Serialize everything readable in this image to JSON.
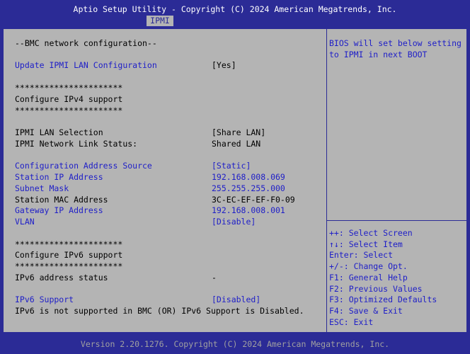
{
  "header": {
    "title": "Aptio Setup Utility - Copyright (C) 2024 American Megatrends, Inc.",
    "active_tab": "IPMI"
  },
  "main": {
    "section_title": "--BMC network configuration--",
    "update_lan": {
      "label": "Update IPMI LAN Configuration",
      "value": "[Yes]"
    },
    "ipv4": {
      "stars_top": "**********************",
      "heading": "Configure IPv4 support",
      "stars_bottom": "**********************"
    },
    "lan_selection": {
      "label": "IPMI LAN Selection",
      "value": "[Share LAN]"
    },
    "link_status": {
      "label": "IPMI Network Link Status:",
      "value": "Shared LAN"
    },
    "config_source": {
      "label": "Configuration Address Source",
      "value": "[Static]"
    },
    "station_ip": {
      "label": "Station IP Address",
      "value": "192.168.008.069"
    },
    "subnet": {
      "label": "Subnet Mask",
      "value": "255.255.255.000"
    },
    "mac": {
      "label": "Station MAC Address",
      "value": "3C-EC-EF-EF-F0-09"
    },
    "gateway": {
      "label": "Gateway IP Address",
      "value": "192.168.008.001"
    },
    "vlan": {
      "label": "VLAN",
      "value": "[Disable]"
    },
    "ipv6": {
      "stars_top": "**********************",
      "heading": "Configure IPv6 support",
      "stars_bottom": "**********************"
    },
    "ipv6_status": {
      "label": "IPv6 address status",
      "value": "-"
    },
    "ipv6_support": {
      "label": "IPv6 Support",
      "value": "[Disabled]"
    },
    "ipv6_note": "IPv6 is not supported in BMC (OR) IPv6 Support is Disabled."
  },
  "help": {
    "description_line1": "BIOS will set below setting",
    "description_line2": "to IPMI in next BOOT",
    "keys": [
      "++: Select Screen",
      "↑↓: Select Item",
      "Enter: Select",
      "+/-: Change Opt.",
      "F1: General Help",
      "F2: Previous Values",
      "F3: Optimized Defaults",
      "F4: Save & Exit",
      "ESC: Exit"
    ]
  },
  "footer": {
    "version": "Version 2.20.1276. Copyright (C) 2024 American Megatrends, Inc."
  },
  "colors": {
    "background": "#2b2b96",
    "panel": "#b4b4b4",
    "selectable_text": "#1e1ec8",
    "static_text": "#000000",
    "header_text": "#ffffff"
  }
}
